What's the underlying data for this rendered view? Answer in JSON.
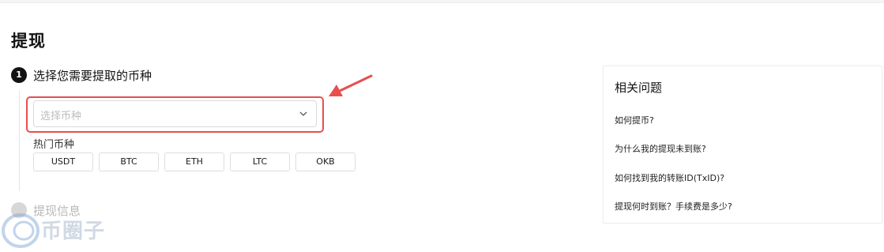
{
  "page": {
    "title": "提现"
  },
  "step1": {
    "number": "1",
    "title": "选择您需要提取的币种"
  },
  "select": {
    "placeholder": "选择币种"
  },
  "hot": {
    "label": "热门币种",
    "coins": [
      "USDT",
      "BTC",
      "ETH",
      "LTC",
      "OKB"
    ]
  },
  "step2": {
    "title": "提现信息"
  },
  "faq": {
    "title": "相关问题",
    "items": [
      "如何提币?",
      "为什么我的提现未到账?",
      "如何找到我的转账ID(TxID)?",
      "提现何时到账？手续费是多少?"
    ]
  },
  "watermark": {
    "text": "币圈子"
  },
  "colors": {
    "highlight": "#e84e4e",
    "accent": "#121212"
  }
}
